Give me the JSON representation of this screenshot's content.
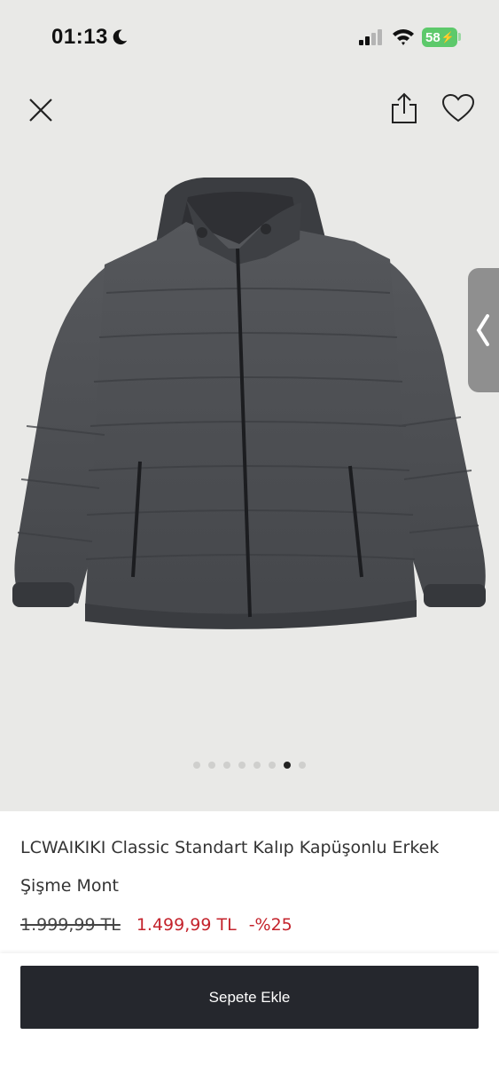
{
  "status_bar": {
    "time": "01:13",
    "battery_level": "58",
    "icons": [
      "moon-icon",
      "signal-icon",
      "wifi-icon",
      "battery-icon"
    ]
  },
  "toolbar": {
    "icons": [
      "close-icon",
      "share-icon",
      "heart-icon"
    ]
  },
  "gallery": {
    "image_count": 8,
    "active_index": 6,
    "side_handle_icon": "chevron-left-icon"
  },
  "product": {
    "title_line1": "LCWAIKIKI Classic Standart Kalıp Kapüşonlu Erkek",
    "title_line2": "Şişme Mont",
    "old_price": "1.999,99 TL",
    "new_price": "1.499,99 TL",
    "discount": "-%25"
  },
  "actions": {
    "add_to_cart": "Sepete Ekle"
  },
  "colors": {
    "accent_red": "#c4232c",
    "button_dark": "#25272d",
    "battery_green": "#5dc96b",
    "jacket": "#4a4c50"
  }
}
